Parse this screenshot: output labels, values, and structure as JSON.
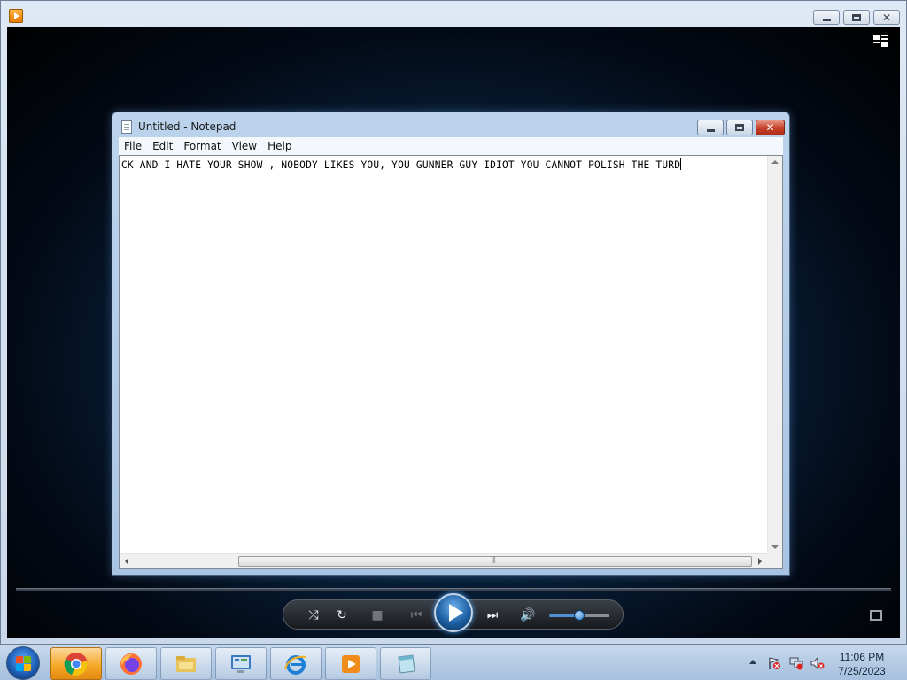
{
  "media_player": {
    "window_controls": {
      "minimize": "minimize",
      "maximize": "restore",
      "close": "close"
    },
    "playback": {
      "volume_level": 0.5
    }
  },
  "notepad": {
    "title": "Untitled - Notepad",
    "menu": [
      "File",
      "Edit",
      "Format",
      "View",
      "Help"
    ],
    "text": "CK AND I HATE YOUR SHOW , NOBODY LIKES YOU, YOU GUNNER GUY IDIOT YOU CANNOT POLISH THE TURD"
  },
  "taskbar": {
    "pinned": [
      {
        "name": "chrome-icon",
        "active": true
      },
      {
        "name": "firefox-icon",
        "active": false
      },
      {
        "name": "file-explorer-icon",
        "active": false
      },
      {
        "name": "control-panel-icon",
        "active": false
      },
      {
        "name": "internet-explorer-icon",
        "active": false
      },
      {
        "name": "windows-media-player-icon",
        "active": false
      },
      {
        "name": "notepad-icon",
        "active": false
      }
    ],
    "clock": {
      "time": "11:06 PM",
      "date": "7/25/2023"
    }
  },
  "colors": {
    "accent": "#1f5fb5",
    "wmp_background": "#08233f",
    "notepad_close": "#c6432b",
    "taskbar_active": "#f5a623"
  }
}
